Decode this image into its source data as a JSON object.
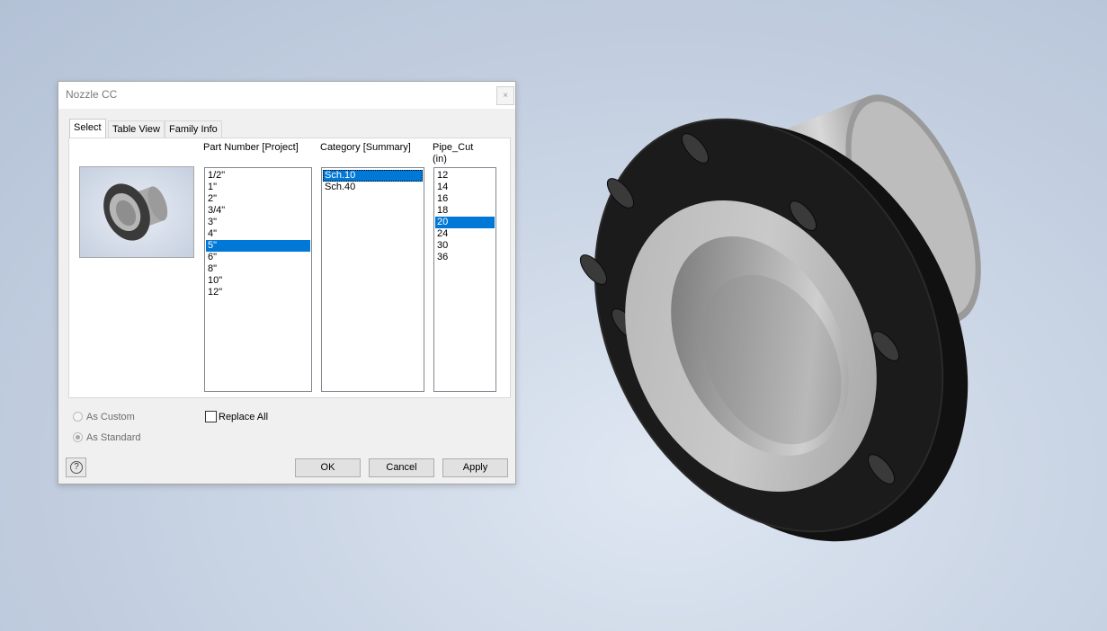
{
  "dialog": {
    "title": "Nozzle CC",
    "close_glyph": "×"
  },
  "tabs": [
    {
      "label": "Select",
      "active": true
    },
    {
      "label": "Table View",
      "active": false
    },
    {
      "label": "Family Info",
      "active": false
    }
  ],
  "columns": {
    "part_number": {
      "header": "Part Number [Project]",
      "items": [
        "1/2\"",
        "1\"",
        "2\"",
        "3/4\"",
        "3\"",
        "4\"",
        "5\"",
        "6\"",
        "8\"",
        "10\"",
        "12\""
      ],
      "selected": "5\""
    },
    "category": {
      "header": "Category [Summary]",
      "items": [
        "Sch.10",
        "Sch.40"
      ],
      "selected": "Sch.10"
    },
    "pipe_cut": {
      "header_line1": "Pipe_Cut",
      "header_line2": "(in)",
      "items": [
        "12",
        "14",
        "16",
        "18",
        "20",
        "24",
        "30",
        "36"
      ],
      "selected": "20"
    }
  },
  "options": {
    "as_custom": "As Custom",
    "as_standard": "As Standard",
    "replace_all": "Replace All",
    "as_standard_checked": true,
    "replace_all_checked": false
  },
  "buttons": {
    "ok": "OK",
    "cancel": "Cancel",
    "apply": "Apply",
    "help_glyph": "?"
  },
  "icons": {
    "help": "help-icon",
    "close": "close-icon",
    "preview": "flange-preview-thumbnail"
  }
}
